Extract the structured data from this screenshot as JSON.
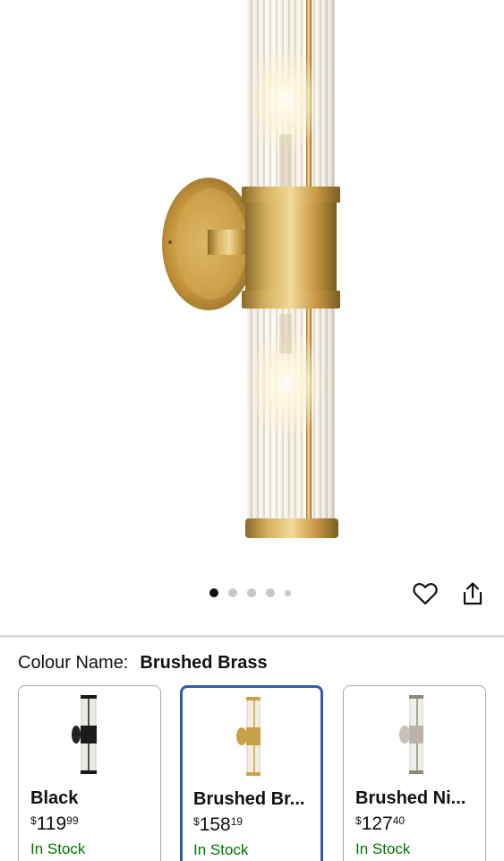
{
  "gallery": {
    "dot_count": 5,
    "active_dot": 0
  },
  "colour": {
    "label": "Colour Name:",
    "value": "Brushed Brass"
  },
  "variants": [
    {
      "name": "Black",
      "price_symbol": "$",
      "price_whole": "119",
      "price_cents": "99",
      "stock": "In Stock",
      "finish_color": "#1a1a1a",
      "selected": false
    },
    {
      "name": "Brushed Br...",
      "price_symbol": "$",
      "price_whole": "158",
      "price_cents": "19",
      "stock": "In Stock",
      "finish_color": "#c9a14a",
      "selected": true
    },
    {
      "name": "Brushed Ni...",
      "price_symbol": "$",
      "price_whole": "127",
      "price_cents": "40",
      "stock": "In Stock",
      "finish_color": "#b9b3ab",
      "selected": false
    }
  ],
  "colors": {
    "brass": "#c59a45",
    "selected_border": "#2a5eaf",
    "stock_green": "#007600"
  }
}
